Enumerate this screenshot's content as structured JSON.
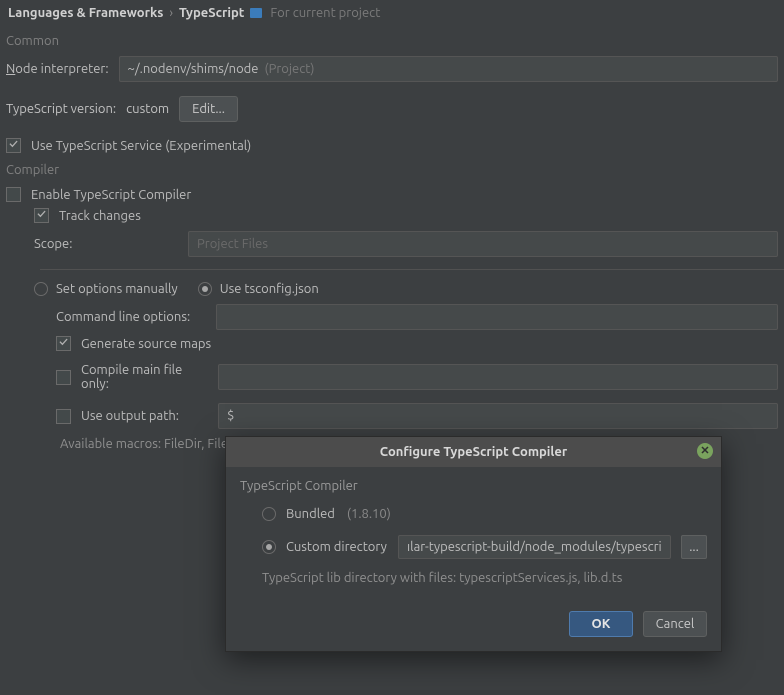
{
  "breadcrumb": {
    "section": "Languages & Frameworks",
    "page": "TypeScript",
    "scopeNote": "For current project"
  },
  "common": {
    "section": "Common",
    "nodeInterpreter": {
      "label": "Node interpreter:",
      "value": "~/.nodenv/shims/node",
      "hint": "(Project)"
    },
    "tsVersion": {
      "label": "TypeScript version:",
      "value": "custom",
      "editBtn": "Edit..."
    },
    "useService": {
      "label": "Use TypeScript Service (Experimental)",
      "checked": true
    }
  },
  "compiler": {
    "section": "Compiler",
    "enable": {
      "label": "Enable TypeScript Compiler",
      "checked": false
    },
    "trackChanges": {
      "label": "Track changes",
      "checked": true
    },
    "scope": {
      "label": "Scope:",
      "placeholder": "Project Files"
    },
    "options": {
      "manual": {
        "label": "Set options manually",
        "checked": false
      },
      "tsconfig": {
        "label": "Use tsconfig.json",
        "checked": true
      }
    },
    "cmdLine": {
      "label": "Command line options:",
      "value": ""
    },
    "generateSourceMaps": {
      "label": "Generate source maps",
      "checked": true
    },
    "compileMainOnly": {
      "label": "Compile main file only:",
      "checked": false,
      "value": ""
    },
    "useOutputPath": {
      "label": "Use output path:",
      "checked": false,
      "value": "$"
    },
    "macrosNote": "Available macros: FileDir, FileRe"
  },
  "dialog": {
    "title": "Configure TypeScript Compiler",
    "groupLabel": "TypeScript Compiler",
    "bundled": {
      "label": "Bundled",
      "version": "(1.8.10)",
      "checked": false
    },
    "custom": {
      "label": "Custom directory",
      "checked": true,
      "value": "ılar-typescript-build/node_modules/typescript/lib"
    },
    "browseBtn": "...",
    "libNote": "TypeScript lib directory with files: typescriptServices.js, lib.d.ts",
    "ok": "OK",
    "cancel": "Cancel"
  }
}
